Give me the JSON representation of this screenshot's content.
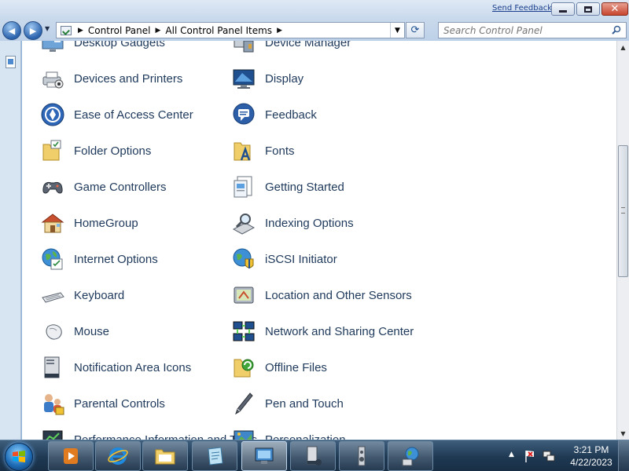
{
  "window": {
    "send_feedback": "Send Feedback",
    "minimize_glyph": "",
    "close_glyph": "✕"
  },
  "nav": {
    "back_glyph": "◀",
    "forward_glyph": "▶",
    "recent_glyph": "▼",
    "breadcrumb": [
      "Control Panel",
      "All Control Panel Items"
    ],
    "crumb_separator": "▶",
    "address_dropdown_glyph": "▼",
    "refresh_glyph": "⟳",
    "search_placeholder": "Search Control Panel"
  },
  "items": {
    "left": [
      {
        "label": "Desktop Gadgets",
        "icon": "desktop-gadgets-icon"
      },
      {
        "label": "Devices and Printers",
        "icon": "devices-printers-icon"
      },
      {
        "label": "Ease of Access Center",
        "icon": "ease-of-access-icon"
      },
      {
        "label": "Folder Options",
        "icon": "folder-options-icon"
      },
      {
        "label": "Game Controllers",
        "icon": "game-controller-icon"
      },
      {
        "label": "HomeGroup",
        "icon": "homegroup-icon"
      },
      {
        "label": "Internet Options",
        "icon": "internet-options-icon"
      },
      {
        "label": "Keyboard",
        "icon": "keyboard-icon"
      },
      {
        "label": "Mouse",
        "icon": "mouse-icon"
      },
      {
        "label": "Notification Area Icons",
        "icon": "notification-area-icon"
      },
      {
        "label": "Parental Controls",
        "icon": "parental-controls-icon"
      },
      {
        "label": "Performance Information and Tools",
        "icon": "performance-icon"
      }
    ],
    "right": [
      {
        "label": "Device Manager",
        "icon": "device-manager-icon"
      },
      {
        "label": "Display",
        "icon": "display-icon"
      },
      {
        "label": "Feedback",
        "icon": "feedback-icon"
      },
      {
        "label": "Fonts",
        "icon": "fonts-icon"
      },
      {
        "label": "Getting Started",
        "icon": "getting-started-icon"
      },
      {
        "label": "Indexing Options",
        "icon": "indexing-options-icon"
      },
      {
        "label": "iSCSI Initiator",
        "icon": "iscsi-icon"
      },
      {
        "label": "Location and Other Sensors",
        "icon": "location-sensors-icon"
      },
      {
        "label": "Network and Sharing Center",
        "icon": "network-sharing-icon"
      },
      {
        "label": "Offline Files",
        "icon": "offline-files-icon"
      },
      {
        "label": "Pen and Touch",
        "icon": "pen-touch-icon"
      },
      {
        "label": "Personalization",
        "icon": "personalization-icon"
      }
    ]
  },
  "scrollbar": {
    "up_glyph": "▲",
    "down_glyph": "▼",
    "position_fraction": 0.42
  },
  "taskbar": {
    "buttons": [
      "media-player-icon",
      "internet-explorer-icon",
      "windows-explorer-icon",
      "notepad-icon",
      "control-panel-icon",
      "task-manager-icon",
      "speaker-icon",
      "network-globe-icon"
    ],
    "active_button": "control-panel-icon",
    "tray_expand_glyph": "▲"
  },
  "clock": {
    "time": "3:21 PM",
    "date": "4/22/2023"
  }
}
